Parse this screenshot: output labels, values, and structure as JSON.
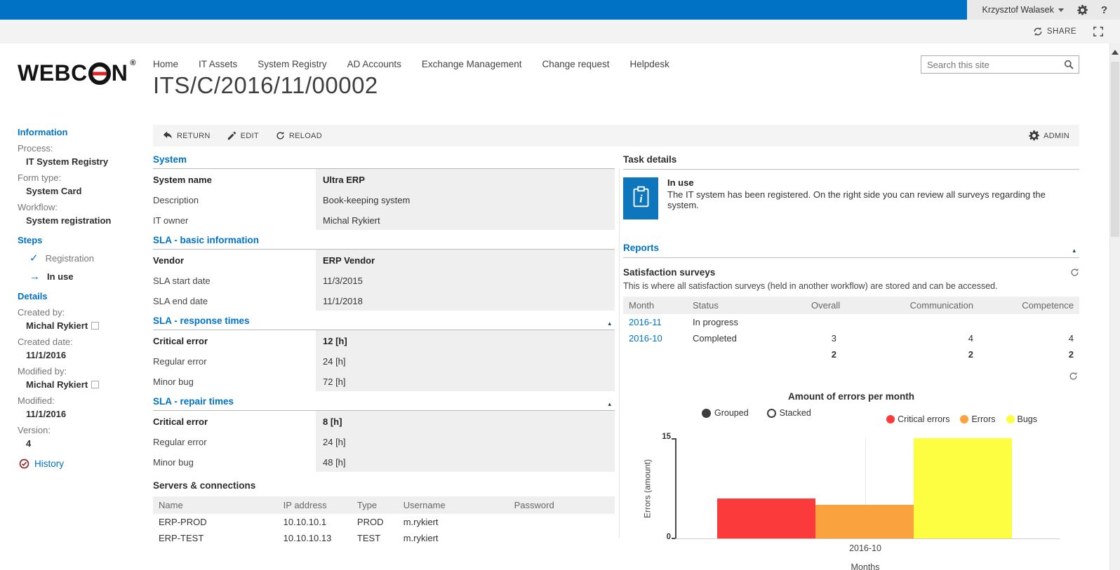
{
  "suite_bar": {
    "user": "Krzysztof Walasek",
    "share_label": "SHARE",
    "help_label": "?"
  },
  "header": {
    "logo_prefix": "WEBC",
    "logo_suffix": "N",
    "logo_registered": "®",
    "nav": [
      "Home",
      "IT Assets",
      "System Registry",
      "AD Accounts",
      "Exchange Management",
      "Change request",
      "Helpdesk"
    ],
    "search_placeholder": "Search this site",
    "page_title": "ITS/C/2016/11/00002"
  },
  "glyphs": {
    "check": "✓",
    "arrow_right": "→",
    "collapse_up": "▴"
  },
  "sidebar": {
    "information_title": "Information",
    "fields": [
      {
        "label": "Process:",
        "value": "IT System Registry"
      },
      {
        "label": "Form type:",
        "value": "System Card"
      },
      {
        "label": "Workflow:",
        "value": "System registration"
      }
    ],
    "steps_title": "Steps",
    "steps": [
      {
        "label": "Registration",
        "state": "done"
      },
      {
        "label": "In use",
        "state": "current"
      }
    ],
    "details_title": "Details",
    "details": [
      {
        "label": "Created by:",
        "value": "Michal Rykiert",
        "presence": true
      },
      {
        "label": "Created date:",
        "value": "11/1/2016",
        "presence": false
      },
      {
        "label": "Modified by:",
        "value": "Michal Rykiert",
        "presence": true
      },
      {
        "label": "Modified:",
        "value": "11/1/2016",
        "presence": false
      },
      {
        "label": "Version:",
        "value": "4",
        "presence": false
      }
    ],
    "history_label": "History"
  },
  "toolbar": {
    "return_label": "RETURN",
    "edit_label": "EDIT",
    "reload_label": "RELOAD",
    "admin_label": "ADMIN"
  },
  "form": {
    "sections": [
      {
        "title": "System",
        "collapsible": false,
        "rows": [
          {
            "label": "System name",
            "value": "Ultra ERP"
          },
          {
            "label": "Description",
            "value": "Book-keeping system"
          },
          {
            "label": "IT owner",
            "value": "Michal Rykiert"
          }
        ]
      },
      {
        "title": "SLA - basic information",
        "collapsible": false,
        "rows": [
          {
            "label": "Vendor",
            "value": "ERP Vendor"
          },
          {
            "label": "SLA start date",
            "value": "11/3/2015"
          },
          {
            "label": "SLA end date",
            "value": "11/1/2018"
          }
        ]
      },
      {
        "title": "SLA - response times",
        "collapsible": true,
        "rows": [
          {
            "label": "Critical error",
            "value": "12 [h]"
          },
          {
            "label": "Regular error",
            "value": "24 [h]"
          },
          {
            "label": "Minor bug",
            "value": "72 [h]"
          }
        ]
      },
      {
        "title": "SLA - repair times",
        "collapsible": true,
        "rows": [
          {
            "label": "Critical error",
            "value": "8 [h]"
          },
          {
            "label": "Regular error",
            "value": "24 [h]"
          },
          {
            "label": "Minor bug",
            "value": "48 [h]"
          }
        ]
      }
    ],
    "servers": {
      "title": "Servers & connections",
      "columns": [
        "Name",
        "IP address",
        "Type",
        "Username",
        "Password"
      ],
      "rows": [
        [
          "ERP-PROD",
          "10.10.10.1",
          "PROD",
          "m.rykiert",
          ""
        ],
        [
          "ERP-TEST",
          "10.10.10.13",
          "TEST",
          "m.rykiert",
          ""
        ]
      ]
    }
  },
  "task_panel": {
    "title": "Task details",
    "step_name": "In use",
    "description": "The IT system has been registered. On the right side you can review all surveys regarding the system.",
    "reports_title": "Reports",
    "surveys": {
      "title": "Satisfaction surveys",
      "subtitle": "This is where all satisfaction surveys (held in another workflow) are stored and can be accessed.",
      "columns": [
        "Month",
        "Status",
        "Overall",
        "Communication",
        "Competence"
      ],
      "rows": [
        [
          "2016-11",
          "In progress",
          "",
          "",
          ""
        ],
        [
          "2016-10",
          "Completed",
          "3",
          "4",
          "4"
        ],
        [
          "",
          "",
          "2",
          "2",
          "2"
        ]
      ]
    }
  },
  "chart_data": {
    "type": "bar",
    "title": "Amount of errors per month",
    "mode_options": [
      "Grouped",
      "Stacked"
    ],
    "mode_selected": "Grouped",
    "categories": [
      "2016-10"
    ],
    "series": [
      {
        "name": "Critical errors",
        "color": "#fb3b3b",
        "values": [
          6
        ]
      },
      {
        "name": "Errors",
        "color": "#faa33e",
        "values": [
          5
        ]
      },
      {
        "name": "Bugs",
        "color": "#fdfd42",
        "values": [
          15
        ]
      }
    ],
    "xlabel": "Months",
    "ylabel": "Errors (amount)",
    "ylim": [
      0,
      15
    ],
    "yticks": [
      0,
      15
    ],
    "grid": "single-vertical-gridline",
    "legend_position": "top-right"
  },
  "colors": {
    "accent_blue": "#0072c6",
    "value_bg": "#efefef",
    "tile_blue": "#0e76bc",
    "history_icon": "#8d2c2c"
  }
}
